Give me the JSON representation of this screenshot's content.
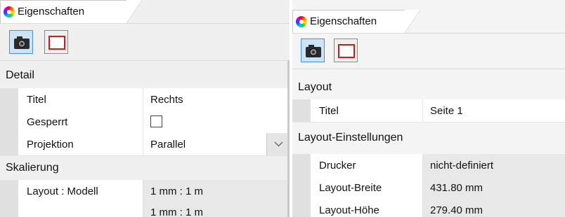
{
  "left_panel": {
    "tab": {
      "label": "Eigenschaften",
      "icon": "color-wheel-icon"
    },
    "toolbar": {
      "camera_icon": "camera-icon",
      "page_icon": "page-layout-icon"
    },
    "section_detail": {
      "title": "Detail",
      "rows": [
        {
          "name": "Titel",
          "value": "Rechts"
        },
        {
          "name": "Gesperrt",
          "value": "",
          "checked": false
        },
        {
          "name": "Projektion",
          "value": "Parallel"
        }
      ]
    },
    "section_scale": {
      "title": "Skalierung",
      "rows": [
        {
          "name": "Layout : Modell",
          "value": "1 mm : 1 m"
        },
        {
          "name": "",
          "value": "1 mm : 1 m"
        }
      ]
    }
  },
  "right_panel": {
    "tab": {
      "label": "Eigenschaften",
      "icon": "color-wheel-icon"
    },
    "toolbar": {
      "camera_icon": "camera-icon",
      "page_icon": "page-layout-icon"
    },
    "section_layout": {
      "title": "Layout",
      "rows": [
        {
          "name": "Titel",
          "value": "Seite 1"
        }
      ]
    },
    "section_settings": {
      "title": "Layout-Einstellungen",
      "rows": [
        {
          "name": "Drucker",
          "value": "nicht-definiert"
        },
        {
          "name": "Layout-Breite",
          "value": "431.80 mm"
        },
        {
          "name": "Layout-Höhe",
          "value": "279.40 mm"
        }
      ]
    }
  }
}
